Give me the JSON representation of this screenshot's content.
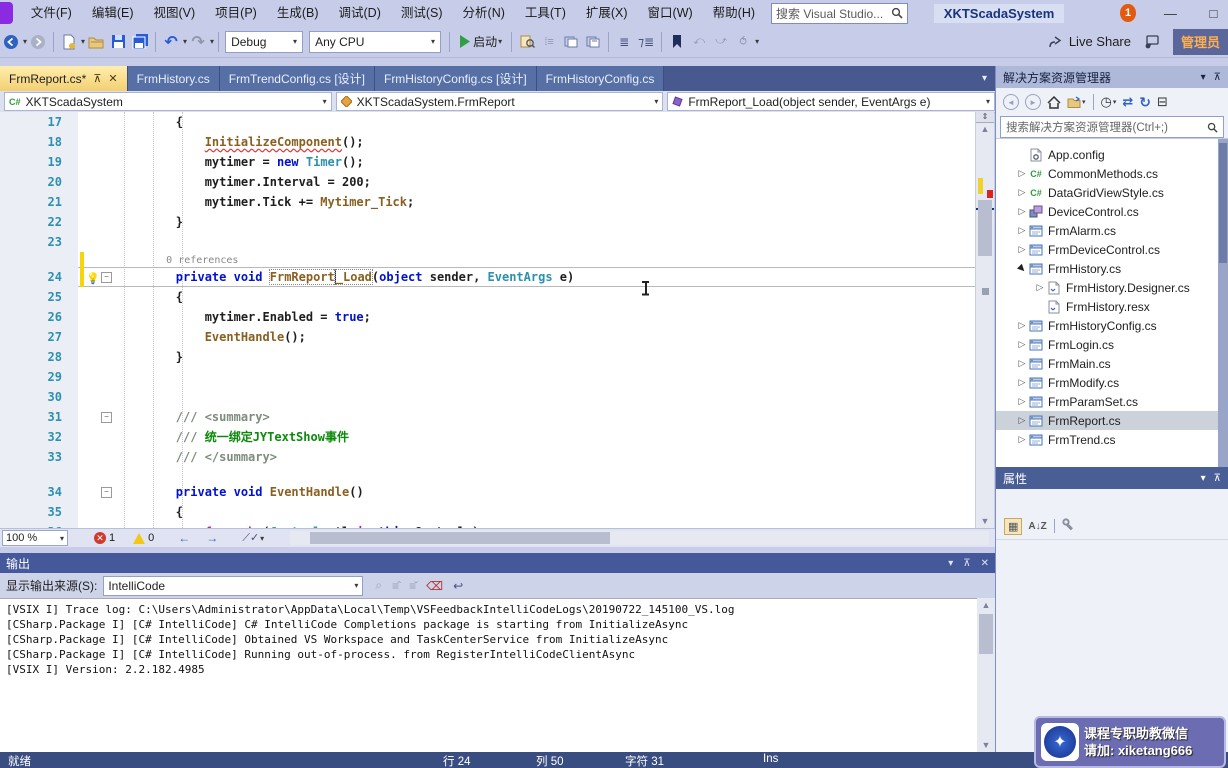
{
  "window": {
    "search_placeholder": "搜索 Visual Studio...",
    "project_badge": "XKTScadaSystem",
    "notification_count": "1",
    "minimize": "—",
    "maximize": "□"
  },
  "menubar": {
    "items": [
      "文件(F)",
      "编辑(E)",
      "视图(V)",
      "项目(P)",
      "生成(B)",
      "调试(D)",
      "测试(S)",
      "分析(N)",
      "工具(T)",
      "扩展(X)",
      "窗口(W)",
      "帮助(H)"
    ]
  },
  "toolbar": {
    "debug_config": "Debug",
    "platform": "Any CPU",
    "start_label": "启动",
    "live_share": "Live Share",
    "admin_button": "管理员"
  },
  "tabs": [
    {
      "label": "FrmReport.cs*",
      "active": true
    },
    {
      "label": "FrmHistory.cs",
      "active": false
    },
    {
      "label": "FrmTrendConfig.cs [设计]",
      "active": false
    },
    {
      "label": "FrmHistoryConfig.cs [设计]",
      "active": false
    },
    {
      "label": "FrmHistoryConfig.cs",
      "active": false
    }
  ],
  "navbar": {
    "project": "XKTScadaSystem",
    "type": "XKTScadaSystem.FrmReport",
    "member": "FrmReport_Load(object sender, EventArgs e)"
  },
  "editor": {
    "zoom": "100 %",
    "error_count": "1",
    "warning_count": "0",
    "lines": [
      {
        "n": "17",
        "segs": [
          [
            "p",
            "        {"
          ]
        ]
      },
      {
        "n": "18",
        "segs": [
          [
            "p",
            "            "
          ],
          [
            "m sq",
            "InitializeComponent"
          ],
          [
            "p",
            "();"
          ]
        ]
      },
      {
        "n": "19",
        "segs": [
          [
            "p",
            "            mytimer = "
          ],
          [
            "k",
            "new"
          ],
          [
            "p",
            " "
          ],
          [
            "t",
            "Timer"
          ],
          [
            "p",
            "();"
          ]
        ]
      },
      {
        "n": "20",
        "segs": [
          [
            "p",
            "            mytimer.Interval = 200;"
          ]
        ]
      },
      {
        "n": "21",
        "segs": [
          [
            "p",
            "            mytimer.Tick += "
          ],
          [
            "m",
            "Mytimer_Tick"
          ],
          [
            "p",
            ";"
          ]
        ]
      },
      {
        "n": "22",
        "segs": [
          [
            "p",
            "        }"
          ]
        ]
      },
      {
        "n": "23",
        "segs": []
      },
      {
        "n": "",
        "lens": true,
        "bar": true,
        "segs": [
          [
            "l",
            "        0 references"
          ]
        ]
      },
      {
        "n": "24",
        "hl": true,
        "bulb": true,
        "bar": true,
        "fold": true,
        "segs": [
          [
            "p",
            "        "
          ],
          [
            "k",
            "private"
          ],
          [
            "p",
            " "
          ],
          [
            "k",
            "void"
          ],
          [
            "p",
            " "
          ],
          [
            "m b1",
            "FrmReport"
          ],
          [
            "m b2",
            "_Load"
          ],
          [
            "p",
            "("
          ],
          [
            "k",
            "object"
          ],
          [
            "p",
            " sender, "
          ],
          [
            "t",
            "EventArgs"
          ],
          [
            "p",
            " e)"
          ]
        ]
      },
      {
        "n": "25",
        "segs": [
          [
            "p",
            "        {"
          ]
        ]
      },
      {
        "n": "26",
        "segs": [
          [
            "p",
            "            mytimer.Enabled = "
          ],
          [
            "k",
            "true"
          ],
          [
            "p",
            ";"
          ]
        ]
      },
      {
        "n": "27",
        "segs": [
          [
            "p",
            "            "
          ],
          [
            "m",
            "EventHandle"
          ],
          [
            "p",
            "();"
          ]
        ]
      },
      {
        "n": "28",
        "segs": [
          [
            "p",
            "        }"
          ]
        ]
      },
      {
        "n": "29",
        "segs": []
      },
      {
        "n": "30",
        "segs": []
      },
      {
        "n": "31",
        "fold": true,
        "segs": [
          [
            "d",
            "        /// <summary>"
          ]
        ]
      },
      {
        "n": "32",
        "segs": [
          [
            "d",
            "        /// "
          ],
          [
            "g",
            "统一绑定JYTextShow事件"
          ]
        ]
      },
      {
        "n": "33",
        "segs": [
          [
            "d",
            "        /// </summary>"
          ]
        ]
      },
      {
        "n": "",
        "lens": true,
        "segs": []
      },
      {
        "n": "34",
        "fold": true,
        "segs": [
          [
            "p",
            "        "
          ],
          [
            "k",
            "private"
          ],
          [
            "p",
            " "
          ],
          [
            "k",
            "void"
          ],
          [
            "p",
            " "
          ],
          [
            "m",
            "EventHandle"
          ],
          [
            "p",
            "()"
          ]
        ]
      },
      {
        "n": "35",
        "segs": [
          [
            "p",
            "        {"
          ]
        ]
      },
      {
        "n": "36",
        "segs": [
          [
            "p",
            "            "
          ],
          [
            "c",
            "foreach"
          ],
          [
            "p",
            " ("
          ],
          [
            "t",
            "Control"
          ],
          [
            "p",
            " ctl "
          ],
          [
            "c",
            "in"
          ],
          [
            "p",
            " "
          ],
          [
            "k",
            "this"
          ],
          [
            "p",
            ".Controls)"
          ]
        ]
      }
    ]
  },
  "solution_explorer": {
    "title": "解决方案资源管理器",
    "search_placeholder": "搜索解决方案资源管理器(Ctrl+;)",
    "items": [
      {
        "arrow": "",
        "icon": "config",
        "label": "App.config",
        "child": false,
        "selected": false
      },
      {
        "arrow": "c",
        "icon": "csharp",
        "label": "CommonMethods.cs",
        "child": false,
        "selected": false
      },
      {
        "arrow": "c",
        "icon": "csharp",
        "label": "DataGridViewStyle.cs",
        "child": false,
        "selected": false
      },
      {
        "arrow": "c",
        "icon": "component",
        "label": "DeviceControl.cs",
        "child": false,
        "selected": false
      },
      {
        "arrow": "c",
        "icon": "form",
        "label": "FrmAlarm.cs",
        "child": false,
        "selected": false
      },
      {
        "arrow": "c",
        "icon": "form",
        "label": "FrmDeviceControl.cs",
        "child": false,
        "selected": false
      },
      {
        "arrow": "e",
        "icon": "form",
        "label": "FrmHistory.cs",
        "child": false,
        "selected": false
      },
      {
        "arrow": "c",
        "icon": "designer",
        "label": "FrmHistory.Designer.cs",
        "child": true,
        "selected": false
      },
      {
        "arrow": "",
        "icon": "designer",
        "label": "FrmHistory.resx",
        "child": true,
        "selected": false
      },
      {
        "arrow": "c",
        "icon": "form",
        "label": "FrmHistoryConfig.cs",
        "child": false,
        "selected": false
      },
      {
        "arrow": "c",
        "icon": "form",
        "label": "FrmLogin.cs",
        "child": false,
        "selected": false
      },
      {
        "arrow": "c",
        "icon": "form",
        "label": "FrmMain.cs",
        "child": false,
        "selected": false
      },
      {
        "arrow": "c",
        "icon": "form",
        "label": "FrmModify.cs",
        "child": false,
        "selected": false
      },
      {
        "arrow": "c",
        "icon": "form",
        "label": "FrmParamSet.cs",
        "child": false,
        "selected": false
      },
      {
        "arrow": "c",
        "icon": "form",
        "label": "FrmReport.cs",
        "child": false,
        "selected": true
      },
      {
        "arrow": "c",
        "icon": "form",
        "label": "FrmTrend.cs",
        "child": false,
        "selected": false
      }
    ]
  },
  "properties": {
    "title": "属性"
  },
  "output": {
    "title": "输出",
    "source_label": "显示输出来源(S):",
    "source_value": "IntelliCode",
    "lines": [
      "[VSIX I] Trace log: C:\\Users\\Administrator\\AppData\\Local\\Temp\\VSFeedbackIntelliCodeLogs\\20190722_145100_VS.log",
      "[CSharp.Package I] [C# IntelliCode] C# IntelliCode Completions package is starting from InitializeAsync",
      "[CSharp.Package I] [C# IntelliCode] Obtained VS Workspace and TaskCenterService from InitializeAsync",
      "[CSharp.Package I] [C# IntelliCode] Running out-of-process. from RegisterIntelliCodeClientAsync",
      "[VSIX I] Version: 2.2.182.4985"
    ]
  },
  "status_bar": {
    "ready": "就绪",
    "line": "行 24",
    "column": "列 50",
    "char": "字符 31",
    "mode": "Ins"
  },
  "badge": {
    "line1": "课程专职助教微信",
    "line2": "请加: xiketang666",
    "star": "✦"
  },
  "colors": {
    "chrome": "#c7cde8",
    "tab_active": "#f3cf72",
    "tab_well": "#47598e",
    "statusbar": "#3a4d80",
    "accent_orange": "#e2590f",
    "keyword": "#0011cf",
    "type": "#2b91af",
    "method": "#8a5f1f",
    "comment_green": "#0c8a0c"
  }
}
